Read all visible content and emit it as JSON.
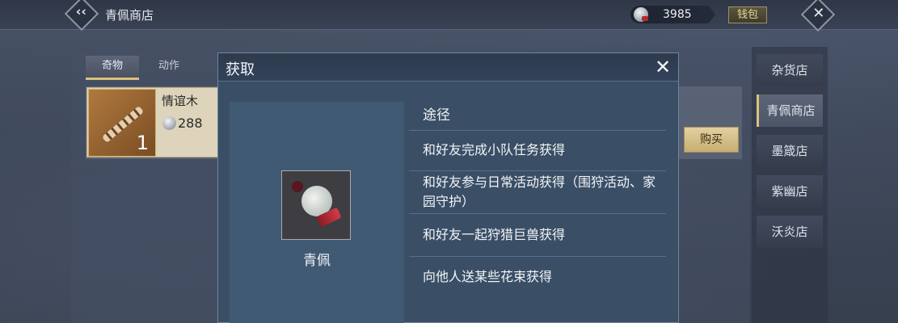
{
  "topbar": {
    "shop_title": "青佩商店",
    "currency_amount": "3985",
    "wallet_label": "钱包"
  },
  "tabs": [
    {
      "label": "奇物",
      "active": true
    },
    {
      "label": "动作",
      "active": false
    }
  ],
  "item": {
    "name": "情谊木",
    "price": "288",
    "quantity": "1",
    "buy_label": "购买"
  },
  "shops": [
    {
      "label": "杂货店",
      "active": false
    },
    {
      "label": "青佩商店",
      "active": true
    },
    {
      "label": "墨箴店",
      "active": false
    },
    {
      "label": "紫幽店",
      "active": false
    },
    {
      "label": "沃炎店",
      "active": false
    }
  ],
  "dialog": {
    "title": "获取",
    "item_name": "青佩",
    "route_header": "途径",
    "routes": [
      "和好友完成小队任务获得",
      "和好友参与日常活动获得（围狩活动、家园守护）",
      "和好友一起狩猎巨兽获得",
      "向他人送某些花束获得"
    ]
  },
  "colors": {
    "accent_gold": "#d9c27b",
    "dialog_bg": "#3a4f66"
  }
}
